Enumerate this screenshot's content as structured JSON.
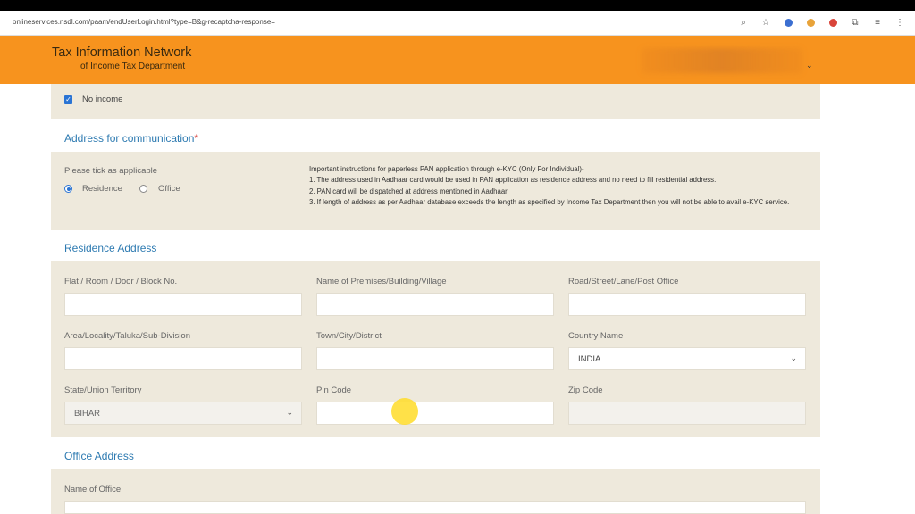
{
  "browser": {
    "url": "onlineservices.nsdl.com/paam/endUserLogin.html?type=B&g-recaptcha-response=",
    "icons": [
      "zoom-icon",
      "star-icon",
      "extension-icon",
      "extensions-puzzle-icon",
      "menu-icon"
    ]
  },
  "header": {
    "title_line1": "Tax Information Network",
    "title_line2": "of Income Tax Department",
    "user_caret": "⌄",
    "color": "#f7931e"
  },
  "income": {
    "no_income_label": "No income",
    "checked": true
  },
  "communication": {
    "title": "Address for communication",
    "required_mark": "*",
    "tick_label": "Please tick as applicable",
    "options": [
      "Residence",
      "Office"
    ],
    "selected": "Residence",
    "instructions": [
      "Important instructions for paperless PAN application through e-KYC (Only For Individual)-",
      "1. The address used in Aadhaar card would be used in PAN application as residence address and no need to fill residential address.",
      "2. PAN card will be dispatched at address mentioned in Aadhaar.",
      "3. If length of address as per Aadhaar database exceeds the length as specified by Income Tax Department then you will not be able to avail e-KYC service."
    ]
  },
  "residence": {
    "title": "Residence Address",
    "fields": {
      "flat": {
        "label": "Flat / Room / Door / Block No.",
        "value": ""
      },
      "premises": {
        "label": "Name of Premises/Building/Village",
        "value": ""
      },
      "road": {
        "label": "Road/Street/Lane/Post Office",
        "value": ""
      },
      "area": {
        "label": "Area/Locality/Taluka/Sub-Division",
        "value": ""
      },
      "town": {
        "label": "Town/City/District",
        "value": ""
      },
      "country": {
        "label": "Country Name",
        "value": "INDIA"
      },
      "state": {
        "label": "State/Union Territory",
        "value": "BIHAR"
      },
      "pin": {
        "label": "Pin Code",
        "value": ""
      },
      "zip": {
        "label": "Zip Code",
        "value": ""
      }
    }
  },
  "office": {
    "title": "Office Address",
    "name_label": "Name of Office"
  }
}
